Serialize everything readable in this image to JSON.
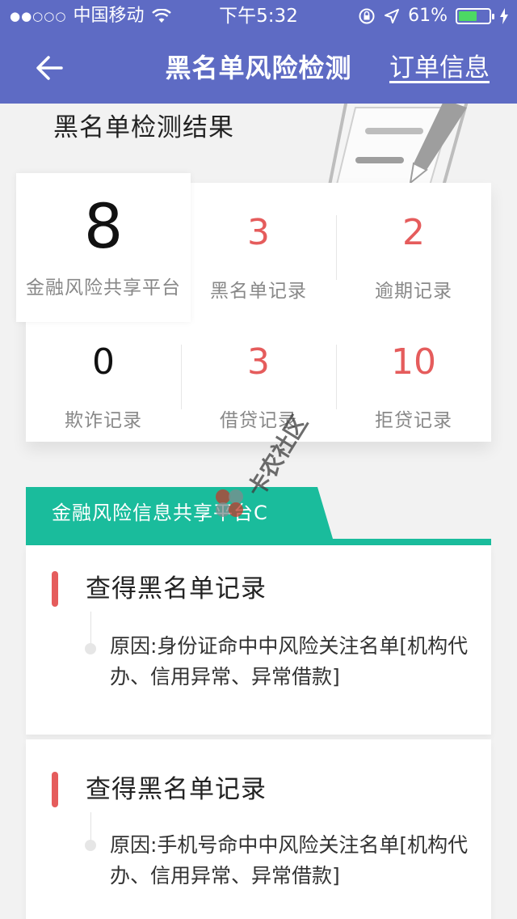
{
  "status_bar": {
    "signal_dots": "●●○○○",
    "carrier": "中国移动",
    "time": "下午5:32",
    "battery_percent": "61%",
    "battery_level": 0.61
  },
  "navbar": {
    "title": "黑名单风险检测",
    "right_link": "订单信息"
  },
  "summary": {
    "title": "黑名单检测结果",
    "platform_count": {
      "value": "8",
      "label": "金融风险共享平台"
    },
    "stats": [
      {
        "value": "3",
        "label": "黑名单记录"
      },
      {
        "value": "2",
        "label": "逾期记录"
      },
      {
        "value": "0",
        "label": "欺诈记录"
      },
      {
        "value": "3",
        "label": "借贷记录"
      },
      {
        "value": "10",
        "label": "拒贷记录"
      }
    ]
  },
  "platform": {
    "tab_label": "金融风险信息共享平台C"
  },
  "records": [
    {
      "heading": "查得黑名单记录",
      "reason": "原因:身份证命中中风险关注名单[机构代办、信用异常、异常借款]"
    },
    {
      "heading": "查得黑名单记录",
      "reason": "原因:手机号命中中风险关注名单[机构代办、信用异常、异常借款]"
    }
  ],
  "watermark": {
    "text": "卡农社区"
  },
  "colors": {
    "header": "#5e6bc4",
    "accent_green": "#1abc9c",
    "alert_red": "#e55c5c"
  }
}
